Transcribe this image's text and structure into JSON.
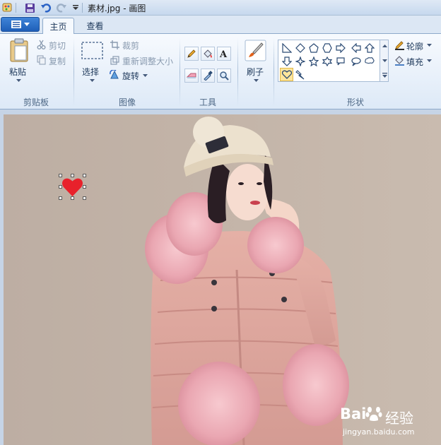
{
  "window": {
    "title": "素材.jpg - 画图"
  },
  "tabs": [
    {
      "label": "主页",
      "active": true
    },
    {
      "label": "查看",
      "active": false
    }
  ],
  "ribbon": {
    "clipboard": {
      "group_label": "剪贴板",
      "paste_label": "粘贴",
      "cut_label": "剪切",
      "copy_label": "复制"
    },
    "image": {
      "group_label": "图像",
      "select_label": "选择",
      "crop_label": "裁剪",
      "resize_label": "重新调整大小",
      "rotate_label": "旋转"
    },
    "tools": {
      "group_label": "工具"
    },
    "brushes": {
      "label": "刷子"
    },
    "shapes": {
      "group_label": "形状",
      "outline_label": "轮廓",
      "fill_label": "填充"
    }
  },
  "watermark": {
    "brand_a": "Bai",
    "brand_b": "经验",
    "url": "jingyan.baidu.com"
  },
  "colors": {
    "heart": "#e8212b",
    "selected_shape": "#fde59b"
  }
}
